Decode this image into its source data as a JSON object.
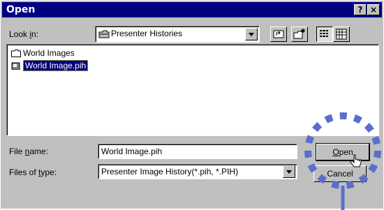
{
  "window": {
    "title": "Open",
    "help_label": "?",
    "close_label": "×"
  },
  "look_in": {
    "label_prefix": "Look ",
    "label_accel": "i",
    "label_suffix": "n:",
    "value": "Presenter Histories"
  },
  "files": [
    {
      "name": "World Images",
      "type": "folder",
      "selected": false
    },
    {
      "name": "World Image.pih",
      "type": "file",
      "selected": true
    }
  ],
  "file_name": {
    "label_prefix": "File ",
    "label_accel": "n",
    "label_suffix": "ame:",
    "value": "World Image.pih"
  },
  "file_type": {
    "label_prefix": "Files of ",
    "label_accel": "t",
    "label_suffix": "ype:",
    "value": "Presenter Image History(*.pih, *.PIH)"
  },
  "buttons": {
    "open_accel": "O",
    "open_rest": "pen",
    "cancel": "Cancel"
  },
  "colors": {
    "title_bar": "#000080",
    "dialog": "#c0c0c0",
    "annotation": "#5a6fcc"
  }
}
